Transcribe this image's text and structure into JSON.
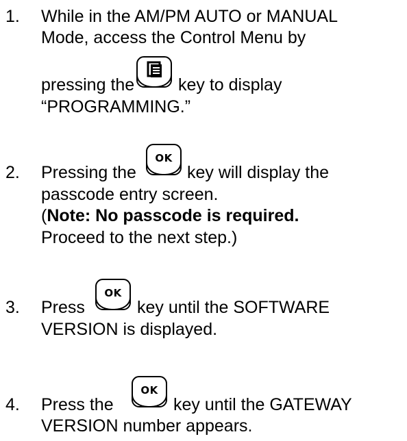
{
  "steps": [
    {
      "number": "1.",
      "line1": "While in the AM/PM AUTO or MANUAL",
      "line2": "Mode, access the Control Menu by",
      "line3_before": "pressing the",
      "line3_after": "key to display",
      "line4": "“PROGRAMMING.”",
      "key_icon": "programming-key-icon"
    },
    {
      "number": "2.",
      "line1_before": "Pressing the",
      "line1_after": "key will display the",
      "line2": "passcode entry screen.",
      "line3_open": "(",
      "line3_bold": "Note: No passcode is required.",
      "line4": "Proceed to the next step.)",
      "key_label": "OK"
    },
    {
      "number": "3.",
      "line1_before": "Press",
      "line1_after": "key until the SOFTWARE",
      "line2": "VERSION is displayed.",
      "key_label": "OK"
    },
    {
      "number": "4.",
      "line1_before": "Press the",
      "line1_after": "key until the GATEWAY",
      "line2": "VERSION number appears.",
      "key_label": "OK"
    }
  ]
}
